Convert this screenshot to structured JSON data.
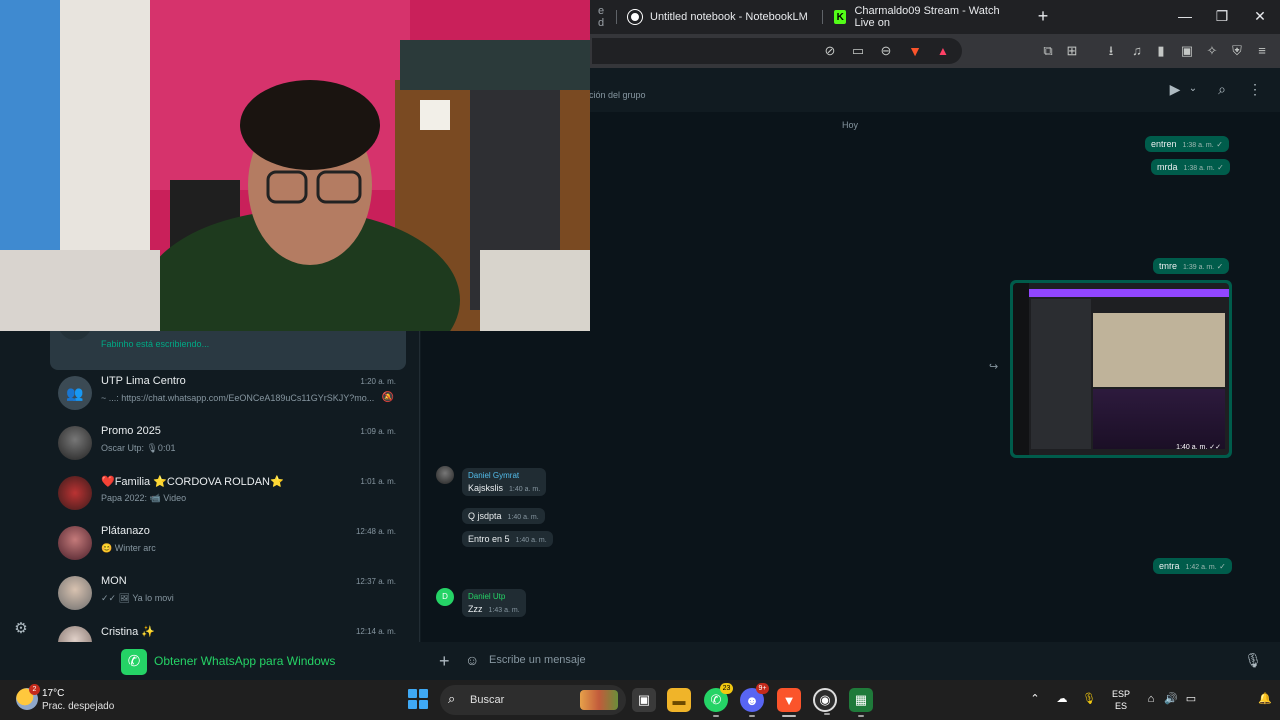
{
  "browser": {
    "tabs": [
      {
        "label": "e d",
        "state": "partial"
      },
      {
        "label": "Untitled notebook - NotebookLM"
      },
      {
        "label": "Charmaldo09 Stream - Watch Live on"
      }
    ],
    "new_tab": "+",
    "controls": {
      "minimize": "—",
      "restore": "❐",
      "close": "✕"
    }
  },
  "sidebar": {
    "chats": [
      {
        "name": "",
        "preview": "Fabinho está escribiendo...",
        "time": "",
        "active": true,
        "typing": true
      },
      {
        "name": "UTP Lima Centro",
        "preview": "~ ...: https://chat.whatsapp.com/EeONCeA189uCs11GYrSKJY?mo...",
        "time": "1:20 a. m.",
        "muted": true
      },
      {
        "name": "Promo 2025",
        "preview": "Oscar Utp: 🎙0:01",
        "time": "1:09 a. m."
      },
      {
        "name": "❤️Familia ⭐CORDOVA ROLDAN⭐",
        "preview": "Papa 2022: 📹 Video",
        "time": "1:01 a. m."
      },
      {
        "name": "Plátanazo",
        "preview": "😊 Winter arc",
        "time": "12:48 a. m."
      },
      {
        "name": "MON",
        "preview": "✓✓ 🖼 Ya lo movi",
        "time": "12:37 a. m."
      },
      {
        "name": "Cristina ✨",
        "preview": "",
        "time": "12:14 a. m."
      }
    ],
    "get_app_label": "Obtener WhatsApp para Windows"
  },
  "conversation": {
    "header_subtitle": "ción del grupo",
    "day_label": "Hoy",
    "messages": [
      {
        "dir": "out",
        "text": "entren",
        "time": "1:38 a. m."
      },
      {
        "dir": "out",
        "text": "mrda",
        "time": "1:38 a. m."
      },
      {
        "dir": "out",
        "text": "tmre",
        "time": "1:39 a. m."
      },
      {
        "dir": "out",
        "type": "image",
        "time": "1:40 a. m."
      },
      {
        "dir": "in",
        "sender": "Daniel Gymrat",
        "text": "Kajskslis",
        "time": "1:40 a. m."
      },
      {
        "dir": "in",
        "text": "Q jsdpta",
        "time": "1:40 a. m."
      },
      {
        "dir": "in",
        "text": "Entro en 5",
        "time": "1:40 a. m."
      },
      {
        "dir": "out",
        "text": "entra",
        "time": "1:42 a. m."
      },
      {
        "dir": "in",
        "sender": "Daniel Utp",
        "sender_initial": "D",
        "text": "Zzz",
        "time": "1:43 a. m."
      }
    ],
    "composer_placeholder": "Escribe un mensaje"
  },
  "taskbar": {
    "weather_temp": "17°C",
    "weather_desc": "Prac. despejado",
    "weather_badge": "2",
    "search_label": "Buscar",
    "whatsapp_badge": "23",
    "discord_badge": "9+",
    "lang_top": "ESP",
    "lang_bottom": "ES"
  },
  "colors": {
    "whatsapp_green": "#25d366",
    "outgoing_bubble": "#005c4b",
    "incoming_bubble": "#202c33",
    "app_bg": "#111b21"
  }
}
